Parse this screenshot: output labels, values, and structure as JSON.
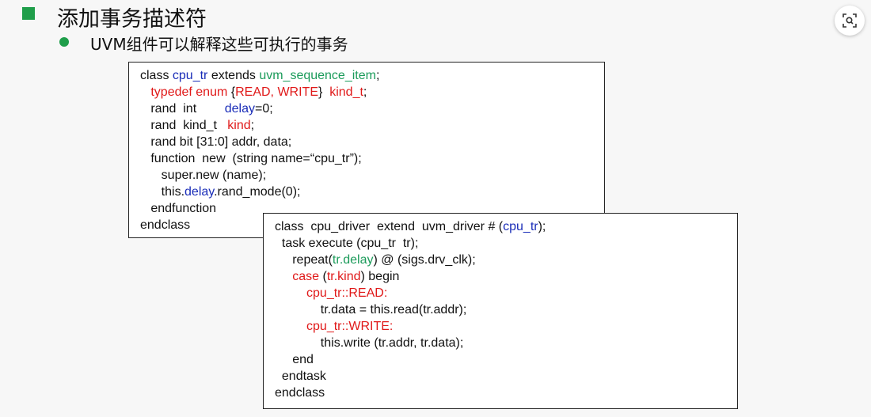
{
  "slide": {
    "title": "添加事务描述符",
    "subtitle": "UVM组件可以解释这些可执行的事务"
  },
  "code1": [
    [
      {
        "t": "class ",
        "c": ""
      },
      {
        "t": "cpu_tr",
        "c": "blue"
      },
      {
        "t": " extends ",
        "c": ""
      },
      {
        "t": "uvm_sequence_item",
        "c": "green"
      },
      {
        "t": ";",
        "c": ""
      }
    ],
    [
      {
        "t": "   ",
        "c": ""
      },
      {
        "t": "typedef enum ",
        "c": "red"
      },
      {
        "t": "{",
        "c": ""
      },
      {
        "t": "READ, WRITE",
        "c": "red"
      },
      {
        "t": "}  ",
        "c": ""
      },
      {
        "t": "kind_t",
        "c": "red"
      },
      {
        "t": ";",
        "c": ""
      }
    ],
    [
      {
        "t": "   rand  int        ",
        "c": ""
      },
      {
        "t": "delay",
        "c": "blue"
      },
      {
        "t": "=0;",
        "c": ""
      }
    ],
    [
      {
        "t": "   rand  kind_t   ",
        "c": ""
      },
      {
        "t": "kind",
        "c": "red"
      },
      {
        "t": ";",
        "c": ""
      }
    ],
    [
      {
        "t": "   rand bit [31:0] addr, data;",
        "c": ""
      }
    ],
    [
      {
        "t": "   function  new  (string name=“cpu_tr”);",
        "c": ""
      }
    ],
    [
      {
        "t": "      super.new (name);",
        "c": ""
      }
    ],
    [
      {
        "t": "      this.",
        "c": ""
      },
      {
        "t": "delay",
        "c": "blue"
      },
      {
        "t": ".rand_mode(0);",
        "c": ""
      }
    ],
    [
      {
        "t": "   endfunction",
        "c": ""
      }
    ],
    [
      {
        "t": "endclass",
        "c": ""
      }
    ]
  ],
  "code2": [
    [
      {
        "t": "class  cpu_driver  extend  uvm_driver # (",
        "c": ""
      },
      {
        "t": "cpu_tr",
        "c": "blue"
      },
      {
        "t": ");",
        "c": ""
      }
    ],
    [
      {
        "t": "  task execute (cpu_tr  tr);",
        "c": ""
      }
    ],
    [
      {
        "t": "     repeat(",
        "c": ""
      },
      {
        "t": "tr.delay",
        "c": "green"
      },
      {
        "t": ") @ (sigs.drv_clk);",
        "c": ""
      }
    ],
    [
      {
        "t": "     ",
        "c": ""
      },
      {
        "t": "case",
        "c": "red"
      },
      {
        "t": " (",
        "c": ""
      },
      {
        "t": "tr.kind",
        "c": "red"
      },
      {
        "t": ") begin",
        "c": ""
      }
    ],
    [
      {
        "t": "         ",
        "c": ""
      },
      {
        "t": "cpu_tr::READ:",
        "c": "red"
      }
    ],
    [
      {
        "t": "             tr.data = this.read(tr.addr);",
        "c": ""
      }
    ],
    [
      {
        "t": "         ",
        "c": ""
      },
      {
        "t": "cpu_tr::WRITE:",
        "c": "red"
      }
    ],
    [
      {
        "t": "             this.write (tr.addr, tr.data);",
        "c": ""
      }
    ],
    [
      {
        "t": "     end",
        "c": ""
      }
    ],
    [
      {
        "t": "  endtask",
        "c": ""
      }
    ],
    [
      {
        "t": "endclass",
        "c": ""
      }
    ]
  ],
  "icons": {
    "top_right": "lens-search-icon"
  },
  "colors": {
    "bullet": "#1f9e4a",
    "keyword_blue": "#1a2db8",
    "keyword_red": "#e01919",
    "keyword_green": "#1b9b5a"
  }
}
